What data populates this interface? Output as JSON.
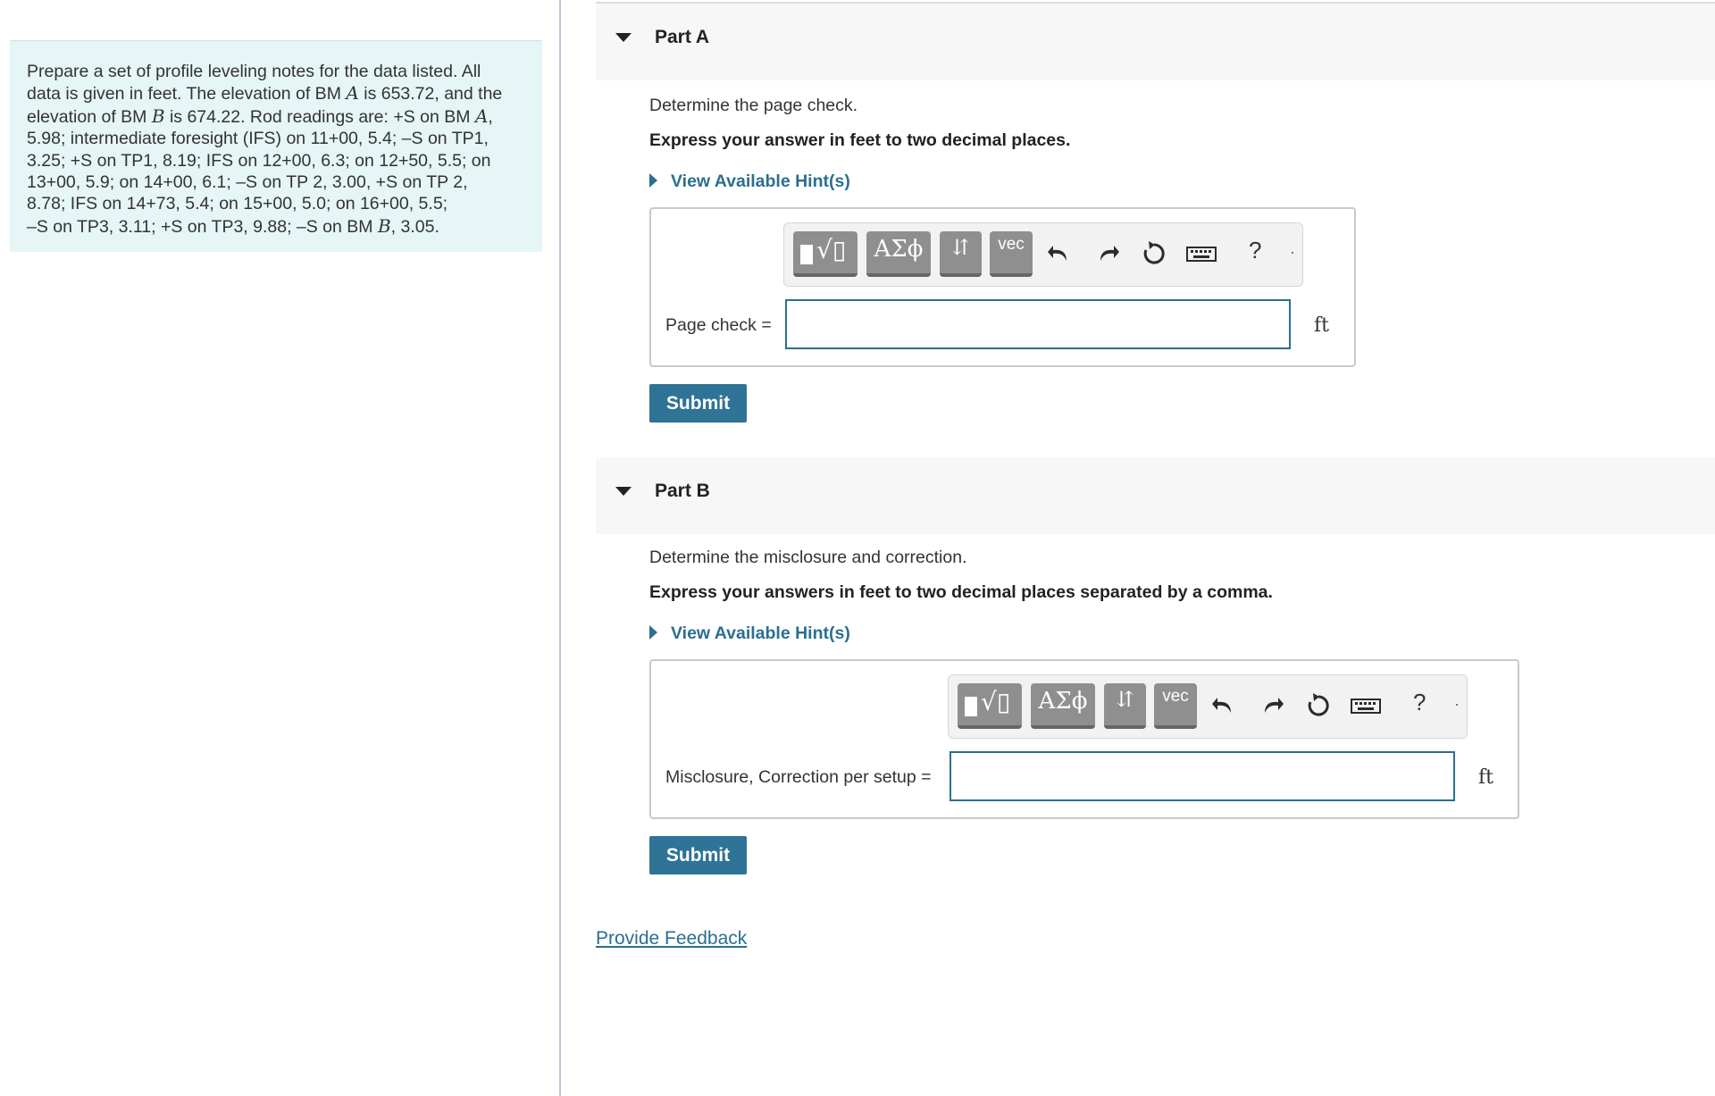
{
  "problem": {
    "lines": [
      [
        "Prepare a set of profile leveling notes for the data listed. All"
      ],
      [
        "data is given in feet. The elevation of BM ",
        "A",
        " is 653.72, and the"
      ],
      [
        "elevation of BM ",
        "B",
        " is 674.22. Rod readings are: +S on BM ",
        "A",
        ","
      ],
      [
        "5.98; intermediate foresight (IFS) on 11+00, 5.4; –S on TP1,"
      ],
      [
        "3.25; +S on TP1, 8.19; IFS on 12+00, 6.3; on 12+50, 5.5; on"
      ],
      [
        "13+00, 5.9; on 14+00, 6.1; –S on TP 2, 3.00, +S on TP 2,"
      ],
      [
        "8.78; IFS on 14+73, 5.4; on 15+00, 5.0; on 16+00, 5.5;"
      ],
      [
        "–S on TP3, 3.11; +S on TP3, 9.88; –S on BM ",
        "B",
        ", 3.05."
      ]
    ]
  },
  "toolbar": {
    "greek_label": "ΑΣϕ",
    "arrows_label": "⇵",
    "vec_label": "vec",
    "help_label": "?"
  },
  "part_a": {
    "title": "Part A",
    "question": "Determine the page check.",
    "instruction": "Express your answer in feet to two decimal places.",
    "hint_label": "View Available Hint(s)",
    "field_label": "Page check =",
    "input_value": "",
    "unit": "ft",
    "submit_label": "Submit"
  },
  "part_b": {
    "title": "Part B",
    "question": "Determine the misclosure and correction.",
    "instruction": "Express your answers in feet to two decimal places separated by a comma.",
    "hint_label": "View Available Hint(s)",
    "field_label": "Misclosure, Correction per setup =",
    "input_value": "",
    "unit": "ft",
    "submit_label": "Submit"
  },
  "feedback_label": "Provide Feedback",
  "colors": {
    "accent": "#2f7396",
    "link": "#2a6f8f",
    "problem_bg": "#e6f5f6",
    "divider": "#c7c2e0"
  }
}
